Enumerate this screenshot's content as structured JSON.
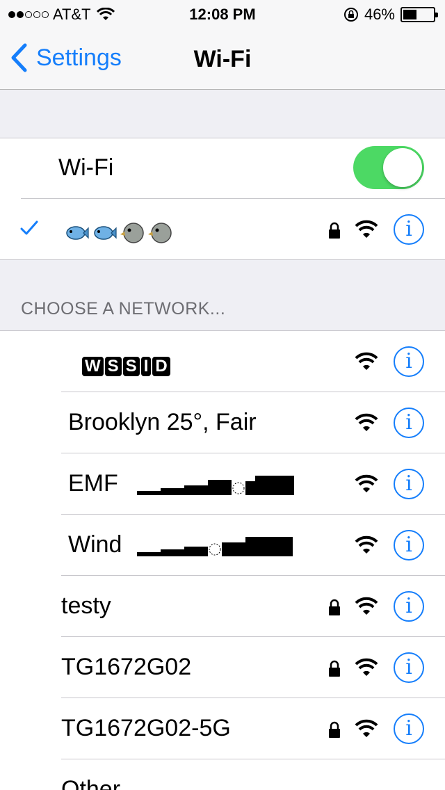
{
  "status_bar": {
    "carrier": "AT&T",
    "time": "12:08 PM",
    "battery": "46%",
    "battery_level": 0.46,
    "signal_bars_filled": 2,
    "signal_bars_total": 5
  },
  "nav": {
    "back_label": "Settings",
    "title": "Wi-Fi"
  },
  "wifi_toggle": {
    "label": "Wi-Fi",
    "on": true
  },
  "connected_network": {
    "name_icons": [
      "fish-icon",
      "fish-icon",
      "bird-icon",
      "bird-icon"
    ],
    "secured": true
  },
  "section_header": "CHOOSE A NETWORK...",
  "networks": [
    {
      "name": "WSSID",
      "boxed": true,
      "secured": false
    },
    {
      "name": "Brooklyn 25°, Fair",
      "secured": false
    },
    {
      "name": "EMF",
      "secured": false
    },
    {
      "name": "Wind",
      "secured": false
    },
    {
      "name": "testy",
      "secured": true
    },
    {
      "name": "TG1672G02",
      "secured": true
    },
    {
      "name": "TG1672G02-5G",
      "secured": true
    },
    {
      "name": "Other...",
      "secured": false
    }
  ],
  "colors": {
    "accent": "#157efb",
    "toggle_on": "#4cd964",
    "background": "#efeff4"
  }
}
